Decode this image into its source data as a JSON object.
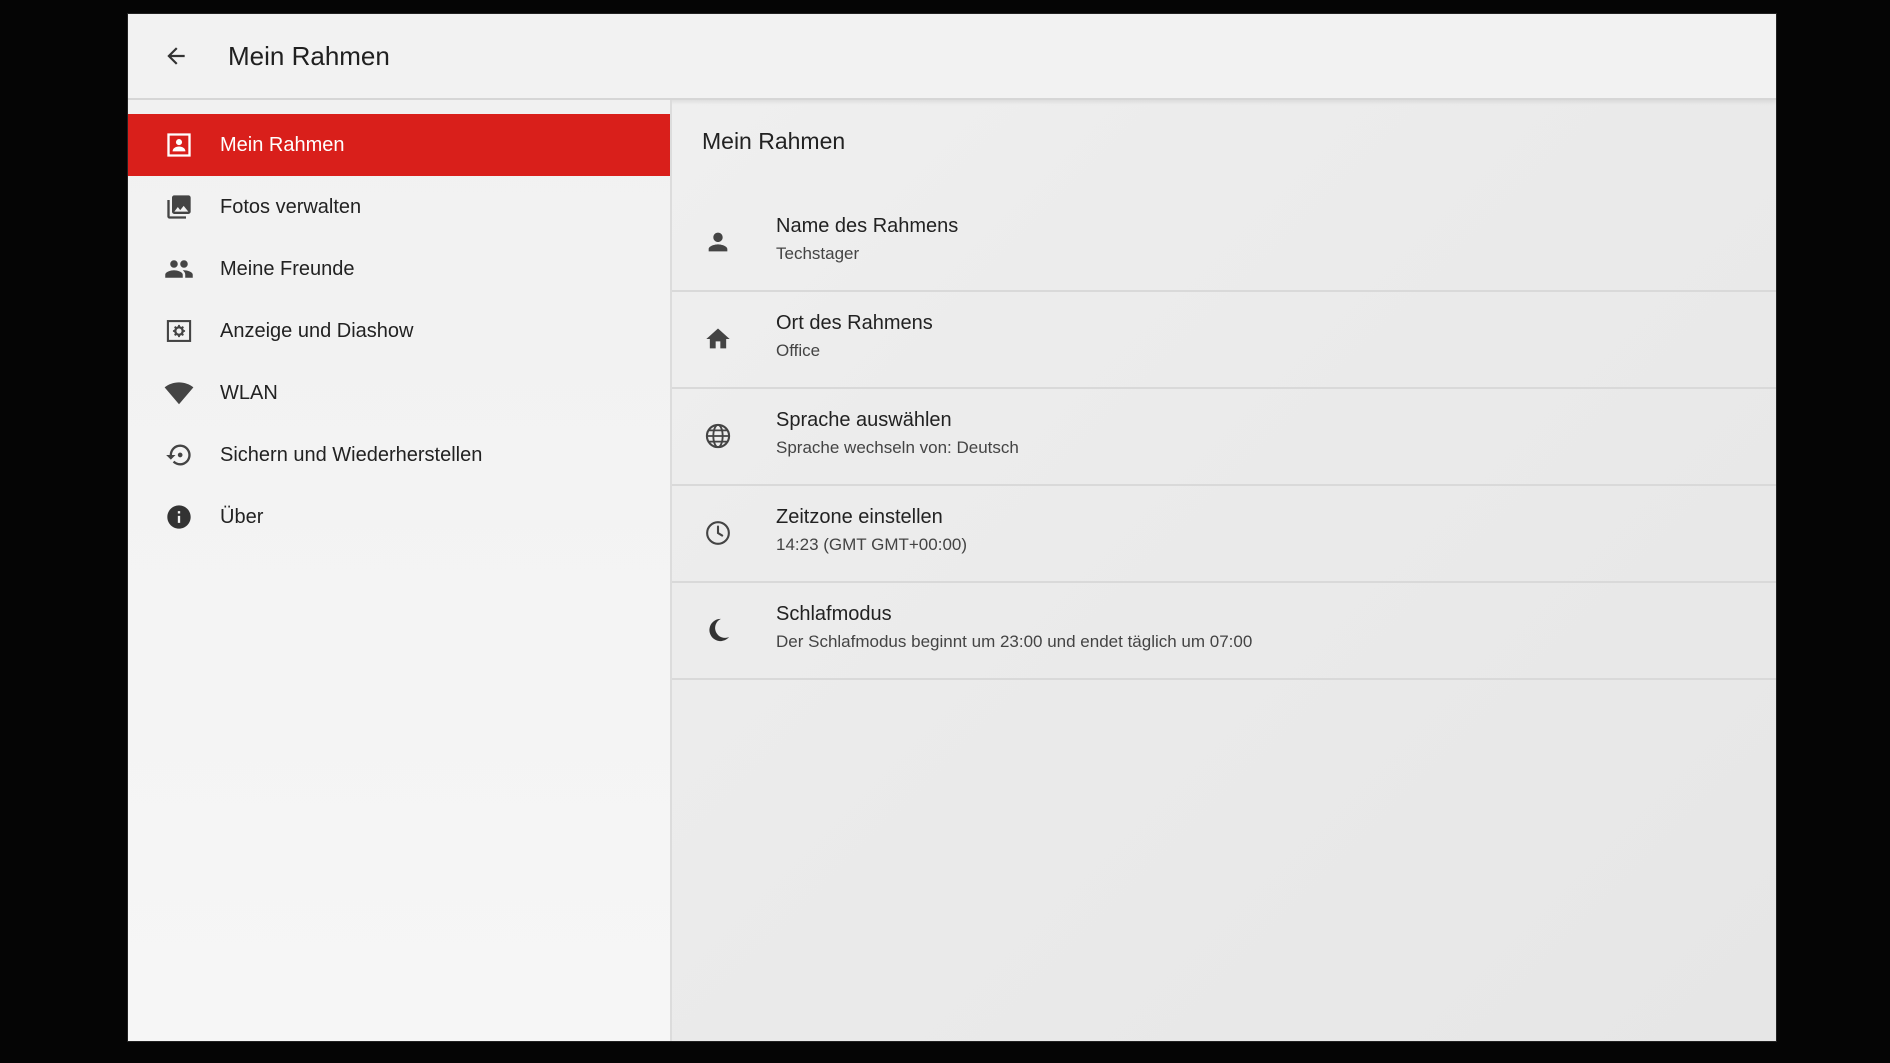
{
  "header": {
    "title": "Mein Rahmen",
    "back_icon": "arrow-back-icon"
  },
  "sidebar": {
    "active_color": "#d91f1b",
    "items": [
      {
        "label": "Mein Rahmen",
        "icon": "frame-icon",
        "active": true
      },
      {
        "label": "Fotos verwalten",
        "icon": "photos-icon",
        "active": false
      },
      {
        "label": "Meine Freunde",
        "icon": "friends-icon",
        "active": false
      },
      {
        "label": "Anzeige und Diashow",
        "icon": "display-settings-icon",
        "active": false
      },
      {
        "label": "WLAN",
        "icon": "wifi-icon",
        "active": false
      },
      {
        "label": "Sichern und Wiederherstellen",
        "icon": "backup-restore-icon",
        "active": false
      },
      {
        "label": "Über",
        "icon": "info-icon",
        "active": false
      }
    ]
  },
  "main": {
    "section_title": "Mein Rahmen",
    "settings": [
      {
        "title": "Name des Rahmens",
        "subtitle": "Techstager",
        "icon": "person-icon"
      },
      {
        "title": "Ort des Rahmens",
        "subtitle": "Office",
        "icon": "home-icon"
      },
      {
        "title": "Sprache auswählen",
        "subtitle": "Sprache wechseln von: Deutsch",
        "icon": "globe-icon"
      },
      {
        "title": "Zeitzone einstellen",
        "subtitle": "14:23 (GMT GMT+00:00)",
        "icon": "clock-icon"
      },
      {
        "title": "Schlafmodus",
        "subtitle": "Der Schlafmodus beginnt um 23:00 und endet täglich um 07:00",
        "icon": "moon-icon"
      }
    ]
  }
}
